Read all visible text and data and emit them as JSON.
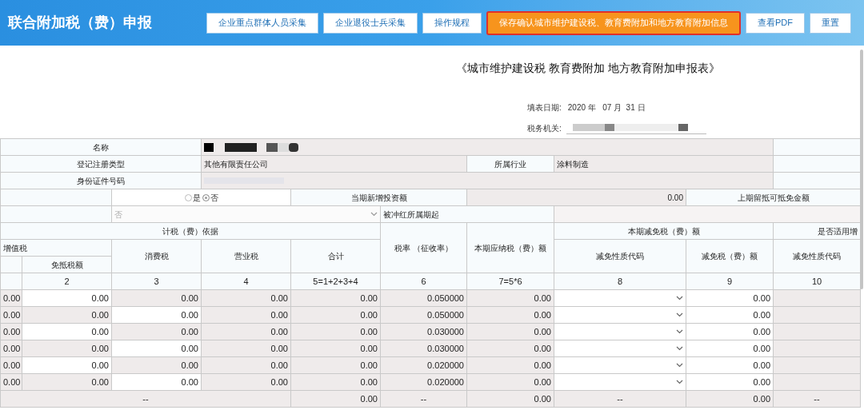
{
  "header": {
    "title": "联合附加税（费）申报",
    "buttons": [
      {
        "label": "企业重点群体人员采集",
        "highlighted": false
      },
      {
        "label": "企业退役士兵采集",
        "highlighted": false
      },
      {
        "label": "操作规程",
        "highlighted": false
      },
      {
        "label": "保存确认城市维护建设税、教育费附加和地方教育附加信息",
        "highlighted": true
      },
      {
        "label": "查看PDF",
        "highlighted": false
      },
      {
        "label": "重置",
        "highlighted": false
      }
    ]
  },
  "form": {
    "title": "《城市维护建设税 教育费附加 地方教育附加申报表》",
    "date_label": "填表日期:",
    "date_value": "2020 年   07 月  31 日",
    "authority_label": "税务机关:"
  },
  "info": {
    "name_label": "名称",
    "reg_type_label": "登记注册类型",
    "reg_type": "其他有限责任公司",
    "industry_label": "所属行业",
    "industry": "涂料制造",
    "id_label": "身份证件号码"
  },
  "options": {
    "radios": [
      {
        "label": "是",
        "selected": false
      },
      {
        "label": "否",
        "selected": true
      }
    ],
    "investment_label": "当期新增投资额",
    "investment": "0.00",
    "credit_label": "上期留抵可抵免金额",
    "select_value": "否",
    "reversal_label": "被冲红所属期起"
  },
  "headers": {
    "basis": "计税（费）依据",
    "vat": "增值税",
    "exempt": "免抵税额",
    "consumption": "消费税",
    "business": "营业税",
    "total": "合计",
    "rate": "税率 （征收率）",
    "payable": "本期应纳税（费）额",
    "relief": "本期减免税（费）额",
    "relief_code": "减免性质代码",
    "relief_amount": "减免税（费）额",
    "applicable": "是否适用增",
    "applicable_code": "减免性质代码"
  },
  "column_numbers": [
    "2",
    "3",
    "4",
    "5=1+2+3+4",
    "6",
    "7=5*6",
    "8",
    "9",
    "10"
  ],
  "rows": [
    {
      "cells": [
        {
          "kind": "readonly",
          "text": "0.00"
        },
        {
          "kind": "input",
          "text": "0.00"
        },
        {
          "kind": "readonly",
          "text": "0.00"
        },
        {
          "kind": "readonly",
          "text": "0.00"
        },
        {
          "kind": "readonly",
          "text": "0.00"
        },
        {
          "kind": "readonly",
          "text": "0.050000"
        },
        {
          "kind": "readonly",
          "text": "0.00"
        },
        {
          "kind": "select"
        },
        {
          "kind": "input",
          "text": "0.00"
        },
        {
          "kind": "readonly"
        }
      ]
    },
    {
      "cells": [
        {
          "kind": "readonly",
          "text": "0.00"
        },
        {
          "kind": "readonly",
          "text": "0.00"
        },
        {
          "kind": "input",
          "text": "0.00"
        },
        {
          "kind": "readonly",
          "text": "0.00"
        },
        {
          "kind": "readonly",
          "text": "0.00"
        },
        {
          "kind": "readonly",
          "text": "0.050000"
        },
        {
          "kind": "readonly",
          "text": "0.00"
        },
        {
          "kind": "select"
        },
        {
          "kind": "input",
          "text": "0.00"
        },
        {
          "kind": "readonly"
        }
      ]
    },
    {
      "cells": [
        {
          "kind": "readonly",
          "text": "0.00"
        },
        {
          "kind": "input",
          "text": "0.00"
        },
        {
          "kind": "readonly",
          "text": "0.00"
        },
        {
          "kind": "readonly",
          "text": "0.00"
        },
        {
          "kind": "readonly",
          "text": "0.00"
        },
        {
          "kind": "readonly",
          "text": "0.030000"
        },
        {
          "kind": "readonly",
          "text": "0.00"
        },
        {
          "kind": "select"
        },
        {
          "kind": "input",
          "text": "0.00"
        },
        {
          "kind": "readonly"
        }
      ]
    },
    {
      "cells": [
        {
          "kind": "readonly",
          "text": "0.00"
        },
        {
          "kind": "readonly",
          "text": "0.00"
        },
        {
          "kind": "input",
          "text": "0.00"
        },
        {
          "kind": "readonly",
          "text": "0.00"
        },
        {
          "kind": "readonly",
          "text": "0.00"
        },
        {
          "kind": "readonly",
          "text": "0.030000"
        },
        {
          "kind": "readonly",
          "text": "0.00"
        },
        {
          "kind": "select"
        },
        {
          "kind": "input",
          "text": "0.00"
        },
        {
          "kind": "readonly"
        }
      ]
    },
    {
      "cells": [
        {
          "kind": "readonly",
          "text": "0.00"
        },
        {
          "kind": "input",
          "text": "0.00"
        },
        {
          "kind": "readonly",
          "text": "0.00"
        },
        {
          "kind": "readonly",
          "text": "0.00"
        },
        {
          "kind": "readonly",
          "text": "0.00"
        },
        {
          "kind": "readonly",
          "text": "0.020000"
        },
        {
          "kind": "readonly",
          "text": "0.00"
        },
        {
          "kind": "select"
        },
        {
          "kind": "input",
          "text": "0.00"
        },
        {
          "kind": "readonly"
        }
      ]
    },
    {
      "cells": [
        {
          "kind": "readonly",
          "text": "0.00"
        },
        {
          "kind": "readonly",
          "text": "0.00"
        },
        {
          "kind": "input",
          "text": "0.00"
        },
        {
          "kind": "readonly",
          "text": "0.00"
        },
        {
          "kind": "readonly",
          "text": "0.00"
        },
        {
          "kind": "readonly",
          "text": "0.020000"
        },
        {
          "kind": "readonly",
          "text": "0.00"
        },
        {
          "kind": "select"
        },
        {
          "kind": "input",
          "text": "0.00"
        },
        {
          "kind": "readonly"
        }
      ]
    }
  ],
  "totals": [
    "--",
    "0.00",
    "--",
    "0.00",
    "--",
    "0.00",
    "--"
  ]
}
